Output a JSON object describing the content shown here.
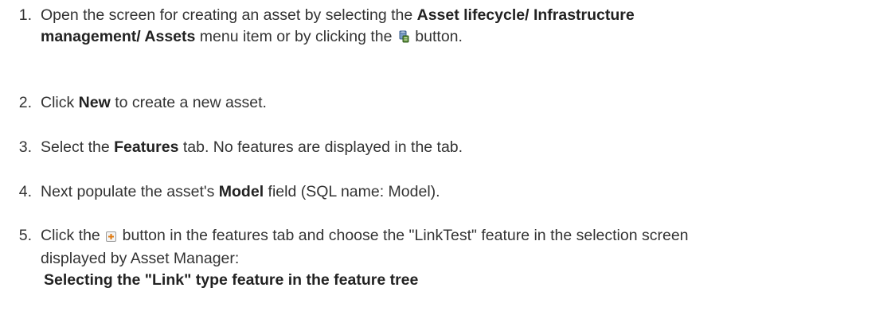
{
  "steps": [
    {
      "number": "1.",
      "line1_a": "Open the screen for creating an asset by selecting the ",
      "line1_bold": "Asset lifecycle/ Infrastructure",
      "line2_bold": "management/ Assets",
      "line2_a": " menu item or by clicking the ",
      "line2_icon": "asset-database-icon",
      "line2_b": " button."
    },
    {
      "number": "2.",
      "text_a": "Click ",
      "bold": "New",
      "text_b": " to create a new asset."
    },
    {
      "number": "3.",
      "text_a": "Select the ",
      "bold": "Features",
      "text_b": " tab. No features are displayed in the tab."
    },
    {
      "number": "4.",
      "text_a": "Next populate the asset's ",
      "bold": "Model",
      "text_b": " field (SQL name: Model)."
    },
    {
      "number": "5.",
      "line1_a": "Click the ",
      "line1_icon": "add-feature-icon",
      "line1_b": " button in the features tab and choose the \"LinkTest\" feature in the selection screen",
      "line2": "displayed by Asset Manager:",
      "caption": "Selecting the \"Link\" type feature in the feature tree"
    }
  ]
}
